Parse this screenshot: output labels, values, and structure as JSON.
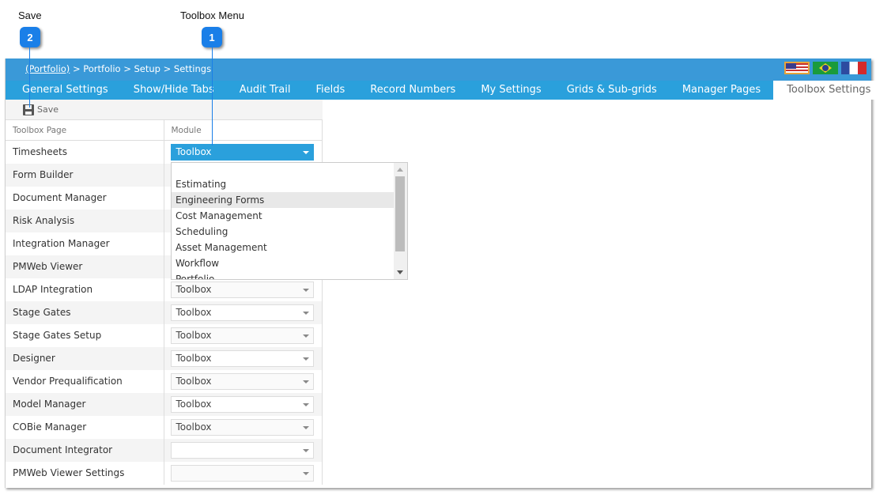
{
  "callouts": [
    {
      "number": "1",
      "label": "Toolbox Menu"
    },
    {
      "number": "2",
      "label": "Save"
    }
  ],
  "breadcrumb": {
    "link": "(Portfolio)",
    "rest": " > Portfolio > Setup > Settings"
  },
  "flags": [
    "us-flag",
    "brazil-flag",
    "france-flag"
  ],
  "tabs": [
    {
      "label": "General Settings"
    },
    {
      "label": "Show/Hide Tabs"
    },
    {
      "label": "Audit Trail"
    },
    {
      "label": "Fields"
    },
    {
      "label": "Record Numbers"
    },
    {
      "label": "My Settings"
    },
    {
      "label": "Grids & Sub-grids"
    },
    {
      "label": "Manager Pages"
    },
    {
      "label": "Toolbox Settings",
      "active": true
    }
  ],
  "toolbar": {
    "save_label": "Save"
  },
  "grid": {
    "headers": [
      "Toolbox Page",
      "Module"
    ],
    "rows": [
      {
        "page": "Timesheets",
        "module": "Toolbox"
      },
      {
        "page": "Form Builder",
        "module": ""
      },
      {
        "page": "Document Manager",
        "module": ""
      },
      {
        "page": "Risk Analysis",
        "module": ""
      },
      {
        "page": "Integration Manager",
        "module": ""
      },
      {
        "page": "PMWeb Viewer",
        "module": ""
      },
      {
        "page": "LDAP Integration",
        "module": "Toolbox"
      },
      {
        "page": "Stage Gates",
        "module": "Toolbox"
      },
      {
        "page": "Stage Gates Setup",
        "module": "Toolbox"
      },
      {
        "page": "Designer",
        "module": "Toolbox"
      },
      {
        "page": "Vendor Prequalification",
        "module": "Toolbox"
      },
      {
        "page": "Model Manager",
        "module": "Toolbox"
      },
      {
        "page": "COBie Manager",
        "module": "Toolbox"
      },
      {
        "page": "Document Integrator",
        "module": ""
      },
      {
        "page": "PMWeb Viewer Settings",
        "module": ""
      }
    ]
  },
  "dropdown": {
    "options": [
      "",
      "Estimating",
      "Engineering Forms",
      "Cost Management",
      "Scheduling",
      "Asset Management",
      "Workflow",
      "Portfolio"
    ],
    "hovered": "Engineering Forms"
  }
}
